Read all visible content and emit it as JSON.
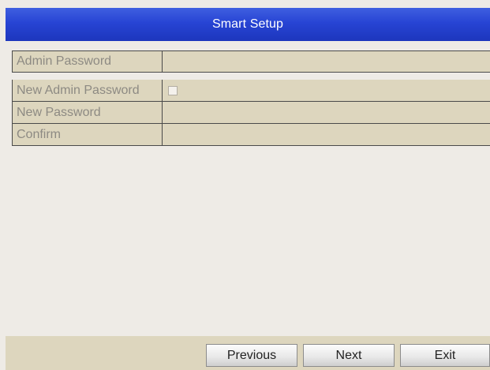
{
  "dialog": {
    "title": "Smart Setup"
  },
  "form": {
    "admin_password_label": "Admin Password",
    "admin_password_value": "",
    "new_admin_password_label": "New Admin Password",
    "new_admin_password_checked": false,
    "new_password_label": "New Password",
    "new_password_value": "",
    "confirm_label": "Confirm",
    "confirm_value": ""
  },
  "buttons": {
    "previous_label": "Previous",
    "next_label": "Next",
    "exit_label": "Exit"
  }
}
